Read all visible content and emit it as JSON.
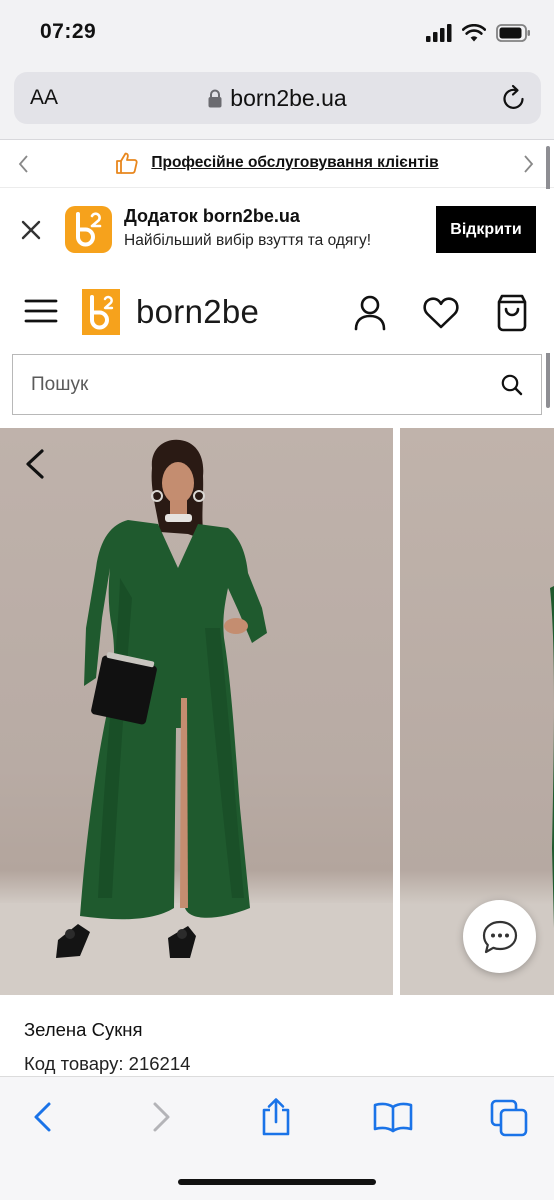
{
  "status_bar": {
    "time": "07:29"
  },
  "safari": {
    "text_size_label": "AA",
    "url": "born2be.ua"
  },
  "promo": {
    "text": "Професійне обслуговування клієнтів"
  },
  "app_banner": {
    "title": "Додаток born2be.ua",
    "subtitle": "Найбільший вибір взуття та одягу!",
    "open_label": "Відкрити",
    "icon_text": "b2"
  },
  "header": {
    "logo_text": "born2be",
    "logo_mark": "b2"
  },
  "search": {
    "placeholder": "Пошук"
  },
  "product": {
    "name": "Зелена Сукня",
    "code": "Код товару: 216214"
  },
  "colors": {
    "brand_orange": "#f6a21c",
    "ios_blue": "#1a73e8",
    "dress_green": "#1f5a2e"
  },
  "icons": {
    "promo": "thumbs-up-icon",
    "account": "user-icon",
    "wishlist": "heart-icon",
    "cart": "shopping-bag-icon",
    "chat": "chat-bubble-icon"
  }
}
